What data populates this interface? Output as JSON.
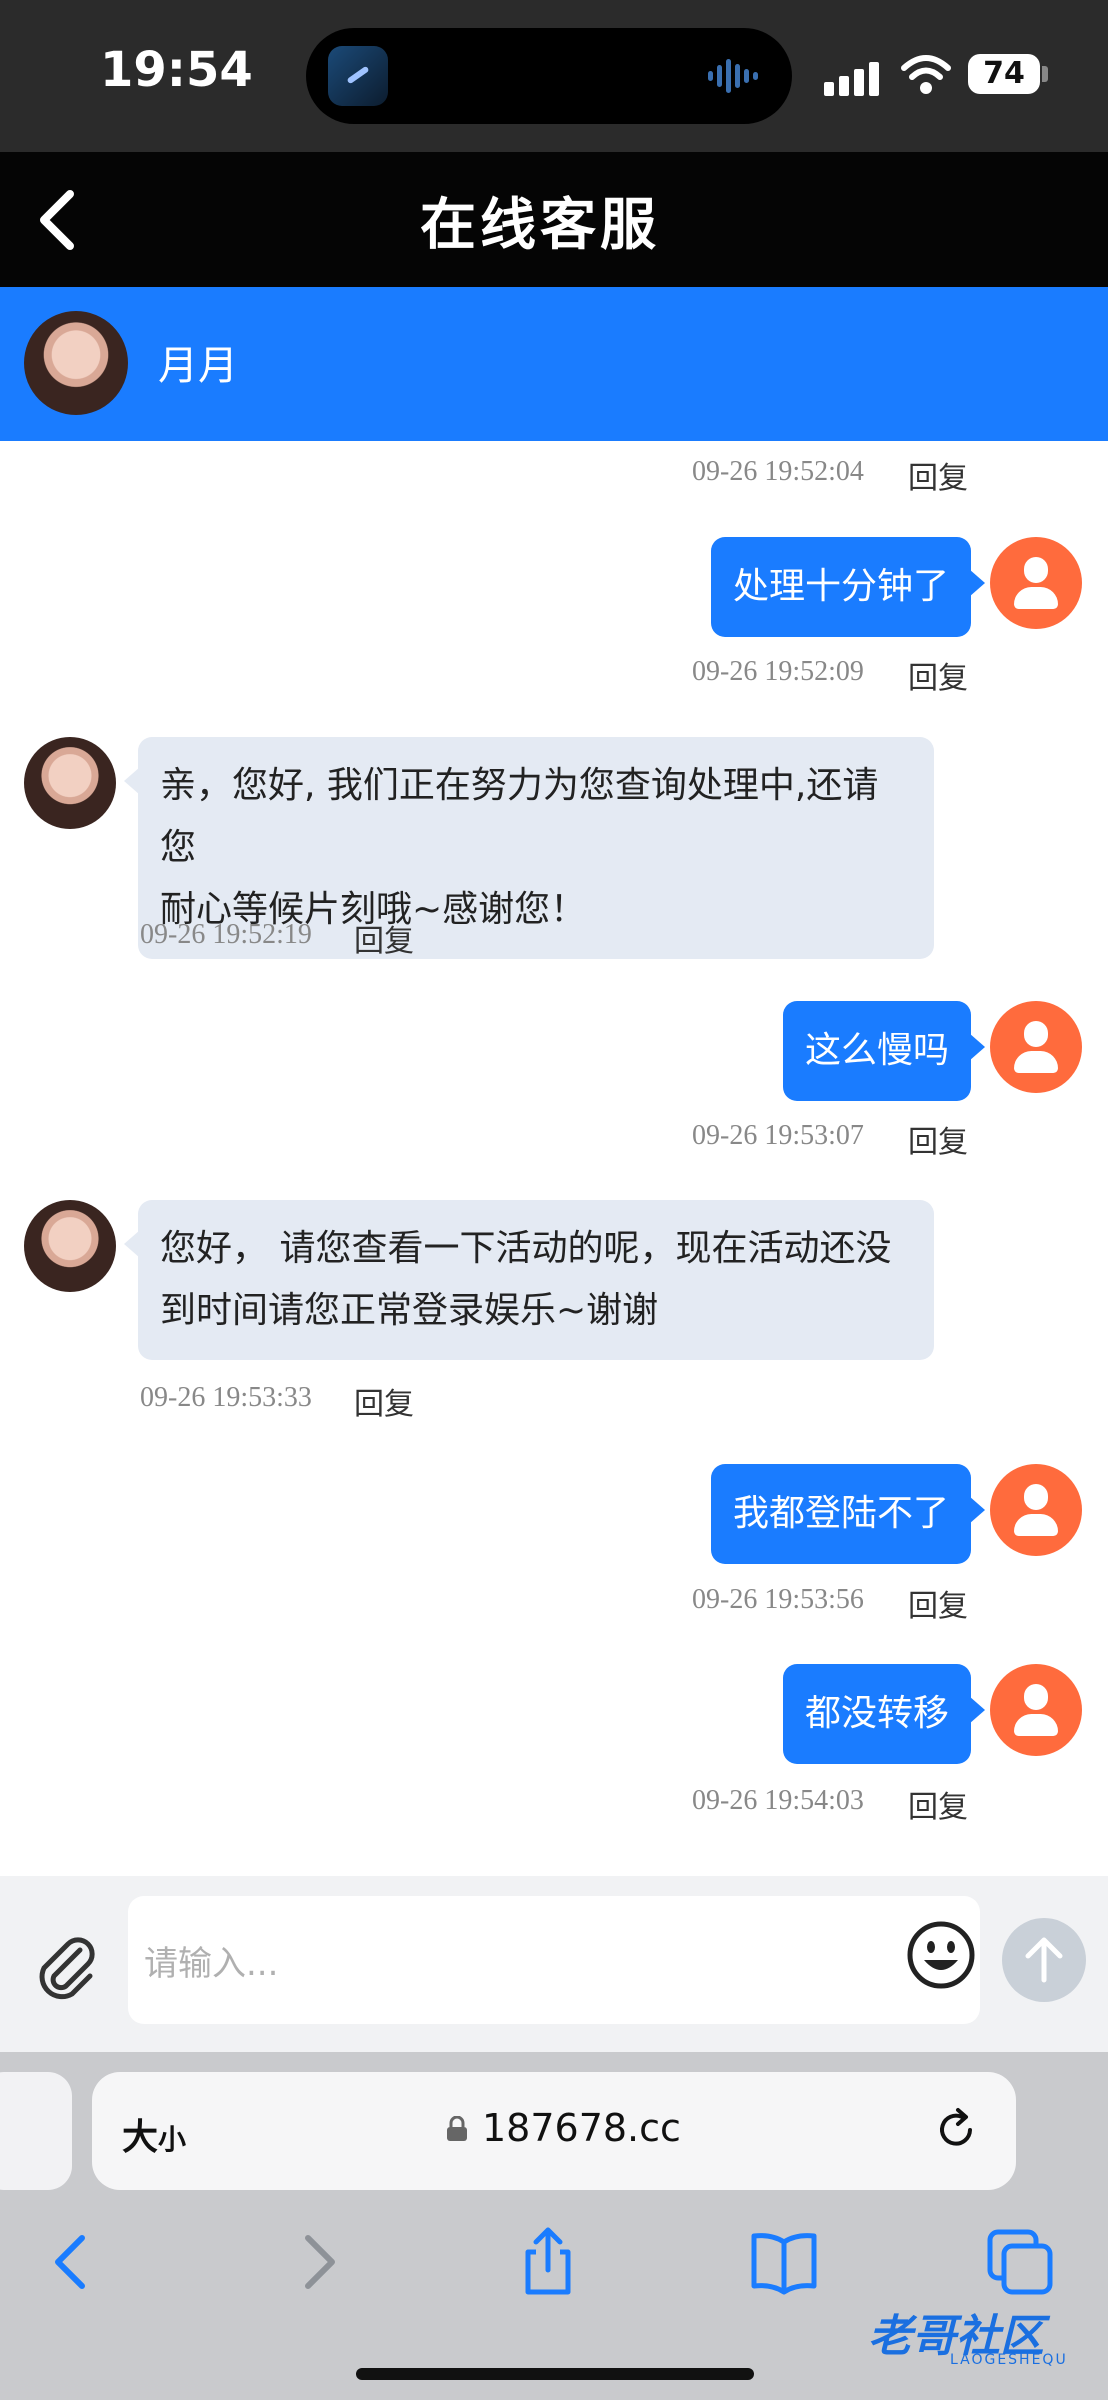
{
  "status_bar": {
    "time": "19:54",
    "battery": "74"
  },
  "header": {
    "title": "在线客服",
    "back_icon": "chevron-left-icon"
  },
  "agent": {
    "name": "月月"
  },
  "colors": {
    "header_bg": "#050505",
    "accent": "#1a7cff",
    "user_avatar": "#ff6b3d",
    "incoming_bubble": "#e4eaf3"
  },
  "chat": {
    "top_meta": {
      "time": "09-26 19:52:04",
      "reply": "回复"
    },
    "messages": [
      {
        "side": "out",
        "text": "处理十分钟了",
        "time": "09-26 19:52:09",
        "reply": "回复"
      },
      {
        "side": "in",
        "line1": "亲，您好, 我们正在努力为您查询处理中,还请您",
        "line2": "耐心等候片刻哦~感谢您！",
        "time": "09-26 19:52:19",
        "reply": "回复"
      },
      {
        "side": "out",
        "text": "这么慢吗",
        "time": "09-26 19:53:07",
        "reply": "回复"
      },
      {
        "side": "in",
        "line1": "您好， 请您查看一下活动的呢，现在活动还没",
        "line2": "到时间请您正常登录娱乐~谢谢",
        "time": "09-26 19:53:33",
        "reply": "回复"
      },
      {
        "side": "out",
        "text": "我都登陆不了",
        "time": "09-26 19:53:56",
        "reply": "回复"
      },
      {
        "side": "out",
        "text": "都没转移",
        "time": "09-26 19:54:03",
        "reply": "回复"
      }
    ]
  },
  "composer": {
    "placeholder": "请输入..."
  },
  "browser": {
    "aa_big": "大",
    "aa_small": "小",
    "url": "187678.cc"
  },
  "watermark": {
    "text": "老哥社区",
    "sub": "LAOGESHEQU"
  }
}
